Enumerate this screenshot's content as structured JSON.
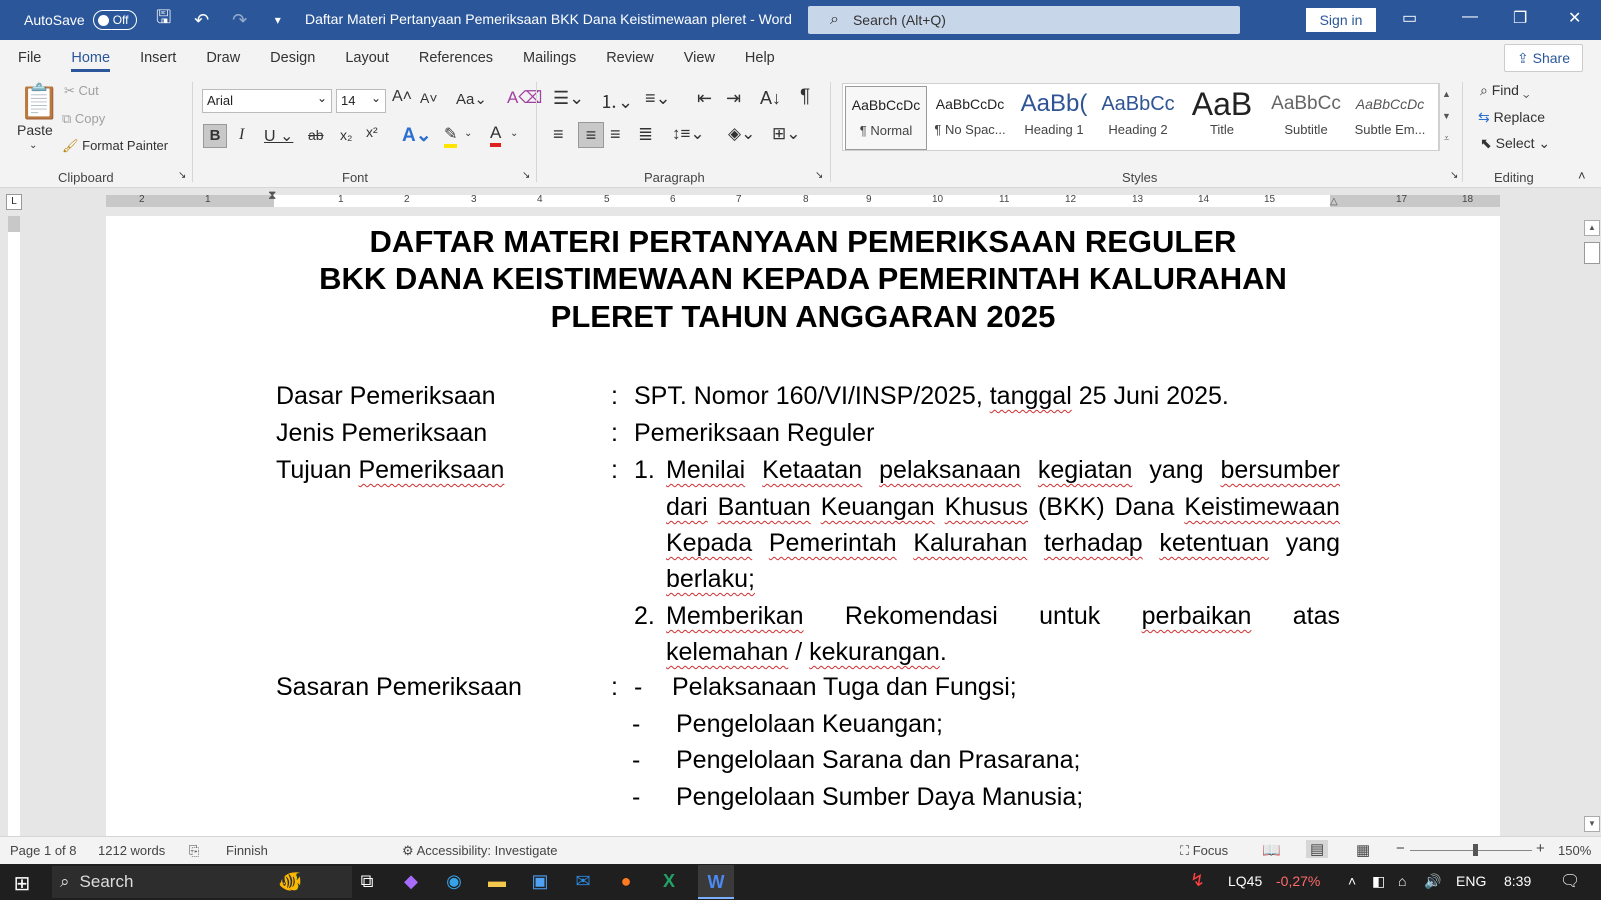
{
  "titlebar": {
    "autosave_label": "AutoSave",
    "autosave_state": "Off",
    "doc_title": "Daftar Materi Pertanyaan Pemeriksaan BKK Dana Keistimewaan pleret  -  Word",
    "search_placeholder": "Search (Alt+Q)",
    "signin_label": "Sign in"
  },
  "tabs": [
    "File",
    "Home",
    "Insert",
    "Draw",
    "Design",
    "Layout",
    "References",
    "Mailings",
    "Review",
    "View",
    "Help"
  ],
  "share_label": "Share",
  "ribbon": {
    "clipboard": {
      "paste": "Paste",
      "cut": "Cut",
      "copy": "Copy",
      "format_painter": "Format Painter",
      "label": "Clipboard"
    },
    "font": {
      "family": "Arial",
      "size": "14",
      "label": "Font"
    },
    "paragraph": {
      "label": "Paragraph"
    },
    "styles": {
      "label": "Styles",
      "items": [
        {
          "preview": "AaBbCcDc",
          "name": "¶ Normal"
        },
        {
          "preview": "AaBbCcDc",
          "name": "¶ No Spac..."
        },
        {
          "preview": "AaBb(",
          "name": "Heading 1"
        },
        {
          "preview": "AaBbCc",
          "name": "Heading 2"
        },
        {
          "preview": "AaB",
          "name": "Title"
        },
        {
          "preview": "AaBbCc",
          "name": "Subtitle"
        },
        {
          "preview": "AaBbCcDc",
          "name": "Subtle Em..."
        }
      ]
    },
    "editing": {
      "find": "Find",
      "replace": "Replace",
      "select": "Select",
      "label": "Editing"
    }
  },
  "ruler_numbers": [
    "2",
    "1",
    "1",
    "2",
    "3",
    "4",
    "5",
    "6",
    "7",
    "8",
    "9",
    "10",
    "11",
    "12",
    "13",
    "14",
    "15",
    "17",
    "18"
  ],
  "document": {
    "heading_lines": [
      "DAFTAR  MATERI  PERTANYAAN PEMERIKSAAN REGULER",
      "BKK DANA KEISTIMEWAAN KEPADA PEMERINTAH KALURAHAN",
      "PLERET TAHUN ANGGARAN  2025"
    ],
    "colon": ":",
    "dasar_label": "Dasar Pemeriksaan",
    "dasar_value_a": "SPT. Nomor 160/VI/INSP/2025, ",
    "dasar_value_b": "tanggal",
    "dasar_value_c": " 25 Juni 2025.",
    "jenis_label": "Jenis Pemeriksaan",
    "jenis_value": "Pemeriksaan Reguler",
    "tujuan_label_a": "Tujuan ",
    "tujuan_label_b": "Pemeriksaan",
    "tujuan_num_1": "1.",
    "tujuan_1_line1": [
      "Menilai",
      "Ketaatan",
      "pelaksanaan",
      "kegiatan",
      "yang",
      "bersumber"
    ],
    "tujuan_1_line2": [
      "dari",
      "Bantuan",
      "Keuangan",
      "Khusus",
      "(BKK)",
      "Dana",
      "Keistimewaan"
    ],
    "tujuan_1_line3": [
      "Kepada",
      "Pemerintah",
      "Kalurahan",
      "terhadap",
      "ketentuan",
      "yang"
    ],
    "tujuan_1_line4": "berlaku;",
    "tujuan_num_2": "2.",
    "tujuan_2_line1": [
      "Memberikan",
      "Rekomendasi",
      "untuk",
      "perbaikan",
      "atas"
    ],
    "tujuan_2_line2_a": "kelemahan",
    "tujuan_2_line2_b": " / ",
    "tujuan_2_line2_c": "kekurangan",
    "tujuan_2_line2_d": ".",
    "sasaran_label": "Sasaran Pemeriksaan",
    "sasaran_dash": "-",
    "sasaran_items": [
      "Pelaksanaan Tuga dan Fungsi;",
      "Pengelolaan Keuangan;",
      "Pengelolaan Sarana dan Prasarana;",
      "Pengelolaan Sumber Daya Manusia;"
    ]
  },
  "statusbar": {
    "page": "Page 1 of 8",
    "words": "1212 words",
    "language": "Finnish",
    "accessibility": "Accessibility: Investigate",
    "focus": "Focus",
    "zoom": "150%"
  },
  "taskbar": {
    "search": "Search",
    "stock_name": "LQ45",
    "stock_change": "-0,27%",
    "lang": "ENG",
    "time": "8:39"
  },
  "colors": {
    "word_blue": "#2b579a",
    "squiggle": "#d03030",
    "stock_red": "#ff6b6b"
  }
}
